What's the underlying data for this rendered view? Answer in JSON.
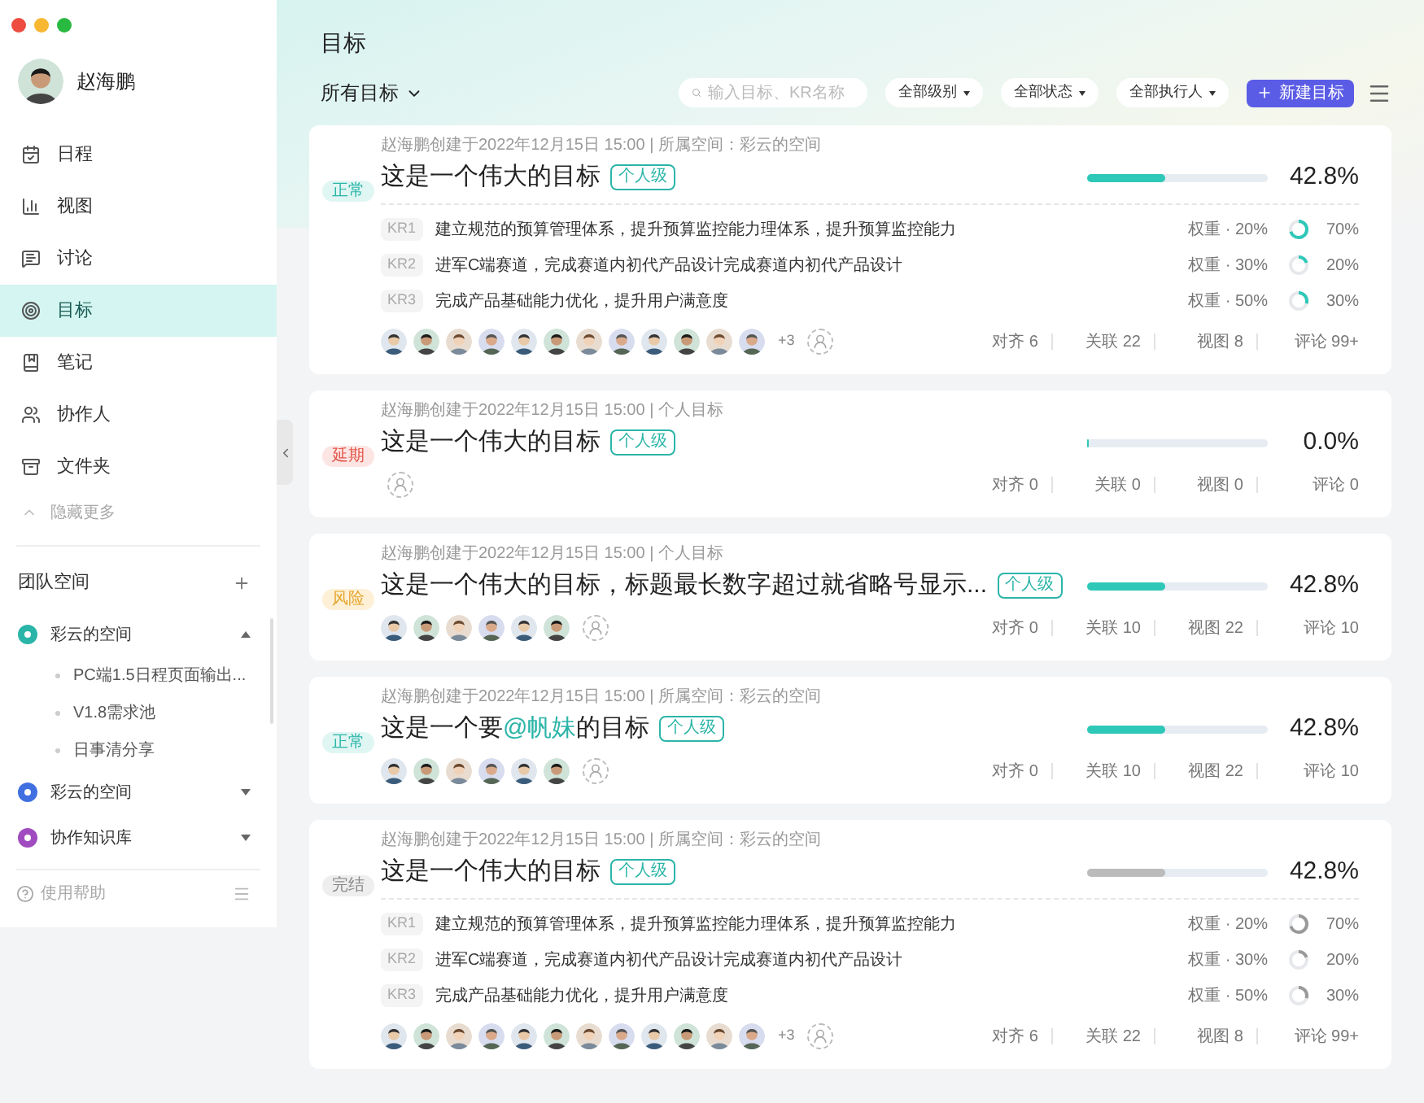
{
  "user": {
    "name": "赵海鹏"
  },
  "nav": [
    {
      "label": "日程",
      "selected": false
    },
    {
      "label": "视图",
      "selected": false
    },
    {
      "label": "讨论",
      "selected": false
    },
    {
      "label": "目标",
      "selected": true
    },
    {
      "label": "笔记",
      "selected": false
    },
    {
      "label": "协作人",
      "selected": false
    },
    {
      "label": "文件夹",
      "selected": false
    }
  ],
  "hide_more": "隐藏更多",
  "team": {
    "title": "团队空间",
    "spaces": [
      {
        "name": "彩云的空间",
        "color": "#2bb5a8",
        "expanded": true,
        "children": [
          {
            "label": "PC端1.5日程页面输出..."
          },
          {
            "label": "V1.8需求池"
          },
          {
            "label": "日事清分享"
          }
        ]
      },
      {
        "name": "彩云的空间",
        "color": "#3f6fe0",
        "expanded": false
      },
      {
        "name": "协作知识库",
        "color": "#a04cc0",
        "expanded": false
      }
    ]
  },
  "help": "使用帮助",
  "page_title": "目标",
  "filter_title": "所有目标",
  "search": {
    "placeholder": "输入目标、KR名称"
  },
  "filters": [
    "全部级别",
    "全部状态",
    "全部执行人"
  ],
  "new_button": "新建目标",
  "goals": [
    {
      "status": {
        "label": "正常",
        "kind": "normal"
      },
      "meta": "赵海鹏创建于2022年12月15日 15:00 | 所属空间：彩云的空间",
      "title": [
        {
          "text": "这是一个伟大的目标",
          "mention": false
        }
      ],
      "tag": "个人级",
      "level": 0.428,
      "percent": "42.8%",
      "krs": [
        {
          "code": "KR1",
          "text": "建立规范的预算管理体系，提升预算监控能力理体系，提升预算监控能力",
          "weight": "权重 · 20%",
          "level": 0.7,
          "percent": "70%"
        },
        {
          "code": "KR2",
          "text": "进军C端赛道，完成赛道内初代产品设计完成赛道内初代产品设计",
          "weight": "权重 · 30%",
          "level": 0.2,
          "percent": "20%"
        },
        {
          "code": "KR3",
          "text": "完成产品基础能力优化，提升用户满意度",
          "weight": "权重 · 50%",
          "level": 0.3,
          "percent": "30%"
        }
      ],
      "avatars": [
        {
          "kind": "picture"
        },
        {
          "kind": "picture"
        },
        {
          "kind": "picture"
        },
        {
          "kind": "picture"
        },
        {
          "kind": "picture"
        },
        {
          "kind": "picture"
        },
        {
          "kind": "picture"
        },
        {
          "kind": "picture"
        },
        {
          "kind": "picture"
        },
        {
          "kind": "picture"
        },
        {
          "kind": "picture"
        },
        {
          "kind": "picture"
        }
      ],
      "more": "+3",
      "stats": [
        "对齐 6",
        "关联 22",
        "视图 8",
        "评论 99+"
      ]
    },
    {
      "status": {
        "label": "延期",
        "kind": "delay"
      },
      "meta": "赵海鹏创建于2022年12月15日 15:00 | 个人目标",
      "title": [
        {
          "text": "这是一个伟大的目标",
          "mention": false
        }
      ],
      "tag": "个人级",
      "level": 0,
      "percent": "0.0%",
      "stats": [
        "对齐 0",
        "关联 0",
        "视图 0",
        "评论 0"
      ]
    },
    {
      "status": {
        "label": "风险",
        "kind": "risk"
      },
      "meta": "赵海鹏创建于2022年12月15日 15:00 | 个人目标",
      "title": [
        {
          "text": "这是一个伟大的目标，标题最长数字超过就省略号显示...",
          "mention": false
        }
      ],
      "tag": "个人级",
      "level": 0.428,
      "percent": "42.8%",
      "avatars": [
        {
          "kind": "picture"
        },
        {
          "kind": "picture"
        },
        {
          "kind": "picture"
        },
        {
          "kind": "picture"
        },
        {
          "kind": "picture"
        },
        {
          "kind": "picture"
        }
      ],
      "stats": [
        "对齐 0",
        "关联 10",
        "视图 22",
        "评论 10"
      ]
    },
    {
      "status": {
        "label": "正常",
        "kind": "normal"
      },
      "meta": "赵海鹏创建于2022年12月15日 15:00 | 所属空间：彩云的空间",
      "title": [
        {
          "text": "这是一个要",
          "mention": false
        },
        {
          "text": "@帆妹",
          "mention": true
        },
        {
          "text": "的目标",
          "mention": false
        }
      ],
      "tag": "个人级",
      "level": 0.428,
      "percent": "42.8%",
      "avatars": [
        {
          "kind": "picture"
        },
        {
          "kind": "picture"
        },
        {
          "kind": "picture"
        },
        {
          "kind": "picture"
        },
        {
          "kind": "picture"
        },
        {
          "kind": "picture"
        }
      ],
      "stats": [
        "对齐 0",
        "关联 10",
        "视图 22",
        "评论 10"
      ]
    },
    {
      "status": {
        "label": "完结",
        "kind": "done"
      },
      "meta": "赵海鹏创建于2022年12月15日 15:00 | 所属空间：彩云的空间",
      "title": [
        {
          "text": "这是一个伟大的目标",
          "mention": false
        }
      ],
      "tag": "个人级",
      "level": 0.428,
      "percent": "42.8%",
      "krs": [
        {
          "code": "KR1",
          "text": "建立规范的预算管理体系，提升预算监控能力理体系，提升预算监控能力",
          "weight": "权重 · 20%",
          "level": 0.7,
          "percent": "70%"
        },
        {
          "code": "KR2",
          "text": "进军C端赛道，完成赛道内初代产品设计完成赛道内初代产品设计",
          "weight": "权重 · 30%",
          "level": 0.2,
          "percent": "20%"
        },
        {
          "code": "KR3",
          "text": "完成产品基础能力优化，提升用户满意度",
          "weight": "权重 · 50%",
          "level": 0.3,
          "percent": "30%"
        }
      ],
      "avatars": [
        {
          "kind": "picture"
        },
        {
          "kind": "picture"
        },
        {
          "kind": "picture"
        },
        {
          "kind": "picture"
        },
        {
          "kind": "picture"
        },
        {
          "kind": "picture"
        },
        {
          "kind": "picture"
        },
        {
          "kind": "picture"
        },
        {
          "kind": "picture"
        },
        {
          "kind": "picture"
        },
        {
          "kind": "picture"
        },
        {
          "kind": "picture"
        }
      ],
      "more": "+3",
      "stats": [
        "对齐 6",
        "关联 22",
        "视图 8",
        "评论 99+"
      ]
    }
  ]
}
